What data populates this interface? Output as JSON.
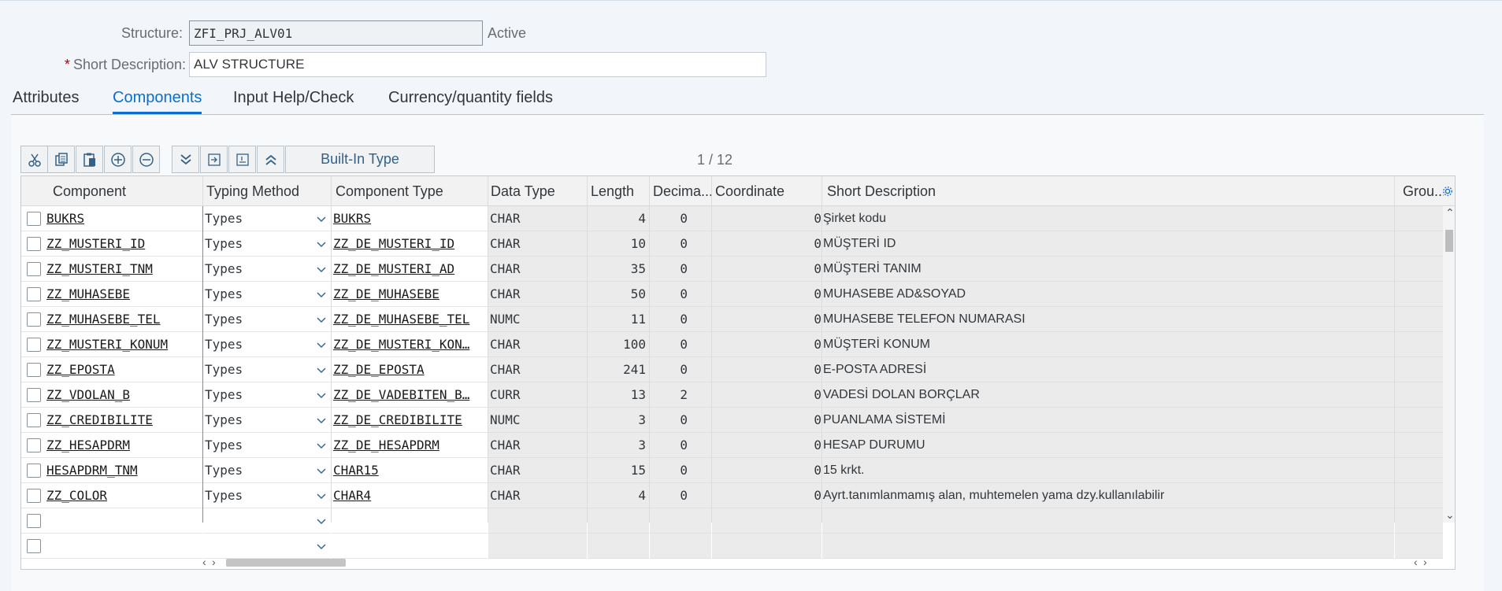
{
  "header": {
    "structure_label": "Structure:",
    "structure_value": "ZFI_PRJ_ALV01",
    "status": "Active",
    "short_desc_required": "*",
    "short_desc_label": "Short Description:",
    "short_desc_value": "ALV STRUCTURE"
  },
  "tabs": [
    {
      "label": "Attributes",
      "selected": false
    },
    {
      "label": "Components",
      "selected": true
    },
    {
      "label": "Input Help/Check",
      "selected": false
    },
    {
      "label": "Currency/quantity fields",
      "selected": false
    }
  ],
  "toolbar": {
    "icons": [
      "cut-icon",
      "copy-icon",
      "paste-icon",
      "insert-row-icon",
      "delete-row-icon",
      "last-page-icon",
      "move-in-icon",
      "move-out-icon",
      "first-page-icon"
    ],
    "builtin_type_label": "Built-In Type",
    "pager": "1  /  12"
  },
  "columns": [
    "Component",
    "Typing Method",
    "Component Type",
    "Data Type",
    "Length",
    "Decima...",
    "Coordinate",
    "Short Description",
    "Grou..."
  ],
  "rows": [
    {
      "component": "BUKRS",
      "typing": "Types",
      "ctype": "BUKRS",
      "dtype": "CHAR",
      "length": "4",
      "decimals": "0",
      "coord": "0",
      "desc": "Şirket kodu"
    },
    {
      "component": "ZZ_MUSTERI_ID",
      "typing": "Types",
      "ctype": "ZZ_DE_MUSTERI_ID",
      "dtype": "CHAR",
      "length": "10",
      "decimals": "0",
      "coord": "0",
      "desc": "MÜŞTERİ ID"
    },
    {
      "component": "ZZ_MUSTERI_TNM",
      "typing": "Types",
      "ctype": "ZZ_DE_MUSTERI_AD",
      "dtype": "CHAR",
      "length": "35",
      "decimals": "0",
      "coord": "0",
      "desc": "MÜŞTERİ TANIM"
    },
    {
      "component": "ZZ_MUHASEBE",
      "typing": "Types",
      "ctype": "ZZ_DE_MUHASEBE",
      "dtype": "CHAR",
      "length": "50",
      "decimals": "0",
      "coord": "0",
      "desc": "MUHASEBE AD&SOYAD"
    },
    {
      "component": "ZZ_MUHASEBE_TEL",
      "typing": "Types",
      "ctype": "ZZ_DE_MUHASEBE_TEL",
      "dtype": "NUMC",
      "length": "11",
      "decimals": "0",
      "coord": "0",
      "desc": "MUHASEBE TELEFON NUMARASI"
    },
    {
      "component": "ZZ_MUSTERI_KONUM",
      "typing": "Types",
      "ctype": "ZZ_DE_MUSTERI_KON…",
      "dtype": "CHAR",
      "length": "100",
      "decimals": "0",
      "coord": "0",
      "desc": "MÜŞTERİ KONUM"
    },
    {
      "component": "ZZ_EPOSTA",
      "typing": "Types",
      "ctype": "ZZ_DE_EPOSTA",
      "dtype": "CHAR",
      "length": "241",
      "decimals": "0",
      "coord": "0",
      "desc": "E-POSTA ADRESİ"
    },
    {
      "component": "ZZ_VDOLAN_B",
      "typing": "Types",
      "ctype": "ZZ_DE_VADEBITEN_B…",
      "dtype": "CURR",
      "length": "13",
      "decimals": "2",
      "coord": "0",
      "desc": "VADESİ DOLAN BORÇLAR"
    },
    {
      "component": "ZZ_CREDIBILITE",
      "typing": "Types",
      "ctype": "ZZ_DE_CREDIBILITE",
      "dtype": "NUMC",
      "length": "3",
      "decimals": "0",
      "coord": "0",
      "desc": "PUANLAMA SİSTEMİ"
    },
    {
      "component": "ZZ_HESAPDRM",
      "typing": "Types",
      "ctype": "ZZ_DE_HESAPDRM",
      "dtype": "CHAR",
      "length": "3",
      "decimals": "0",
      "coord": "0",
      "desc": "HESAP DURUMU"
    },
    {
      "component": "HESAPDRM_TNM",
      "typing": "Types",
      "ctype": "CHAR15",
      "dtype": "CHAR",
      "length": "15",
      "decimals": "0",
      "coord": "0",
      "desc": "15 krkt."
    },
    {
      "component": "ZZ_COLOR",
      "typing": "Types",
      "ctype": "CHAR4",
      "dtype": "CHAR",
      "length": "4",
      "decimals": "0",
      "coord": "0",
      "desc": "Ayrt.tanımlanmamış alan, muhtemelen yama dzy.kullanılabilir"
    },
    {
      "component": "",
      "typing": "",
      "ctype": "",
      "dtype": "",
      "length": "",
      "decimals": "",
      "coord": "",
      "desc": ""
    },
    {
      "component": "",
      "typing": "",
      "ctype": "",
      "dtype": "",
      "length": "",
      "decimals": "",
      "coord": "",
      "desc": ""
    }
  ]
}
